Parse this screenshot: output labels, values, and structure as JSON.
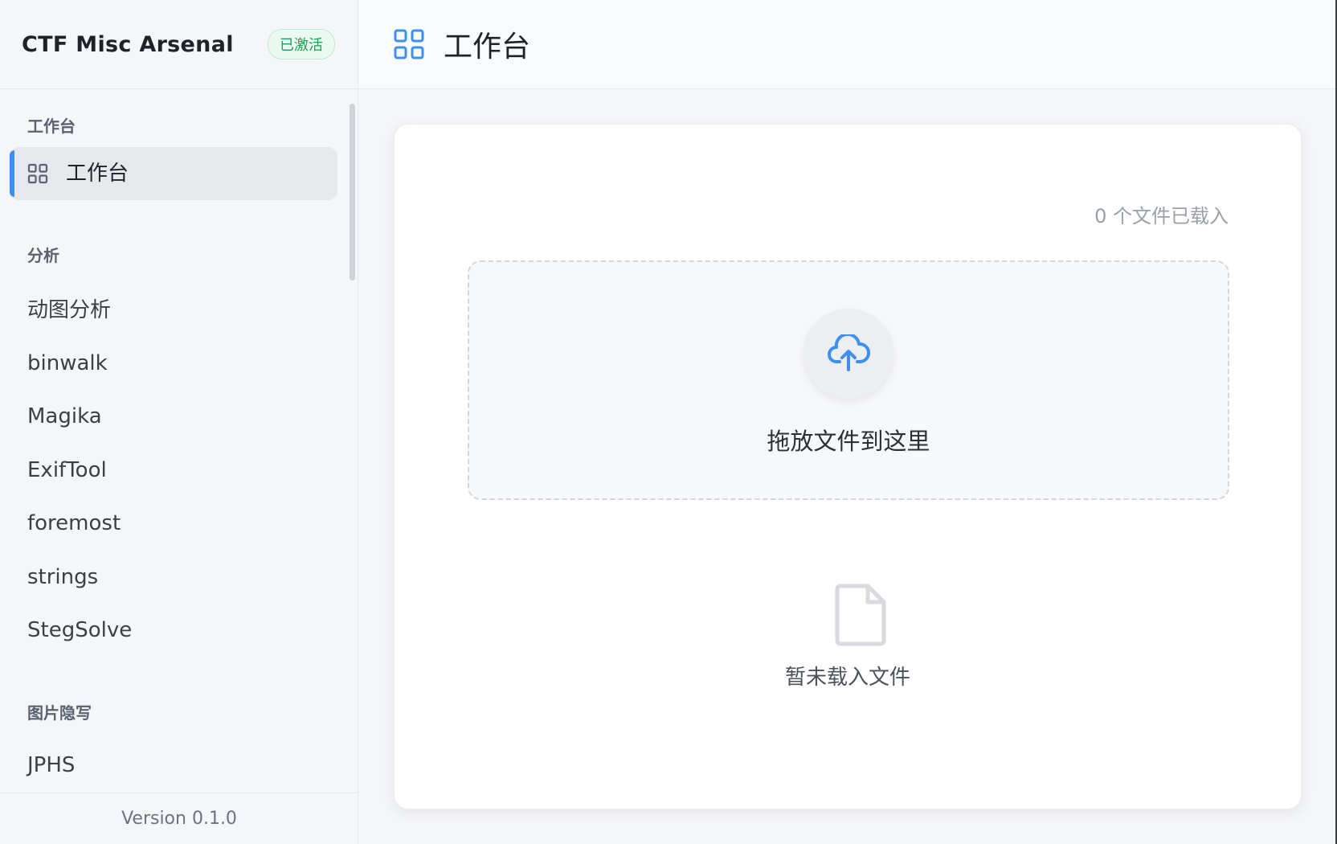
{
  "app": {
    "title": "CTF Misc Arsenal",
    "status_badge": "已激活",
    "version": "Version 0.1.0"
  },
  "sidebar": {
    "groups": [
      {
        "label": "工作台"
      },
      {
        "label": "分析"
      },
      {
        "label": "图片隐写"
      }
    ],
    "active_item": {
      "label": "工作台",
      "icon": "grid-icon"
    },
    "items": [
      {
        "label": "动图分析"
      },
      {
        "label": "binwalk"
      },
      {
        "label": "Magika"
      },
      {
        "label": "ExifTool"
      },
      {
        "label": "foremost"
      },
      {
        "label": "strings"
      },
      {
        "label": "StegSolve"
      },
      {
        "label": "JPHS"
      }
    ]
  },
  "header": {
    "title": "工作台",
    "icon": "grid-icon"
  },
  "main": {
    "file_count": "0 个文件已载入",
    "dropzone": {
      "label": "拖放文件到这里",
      "icon": "cloud-upload-icon"
    },
    "empty_state": {
      "label": "暂未载入文件",
      "icon": "file-icon"
    }
  },
  "colors": {
    "accent": "#3f8ff0",
    "badge_text": "#1e9e55",
    "badge_bg": "#eafaf1"
  }
}
